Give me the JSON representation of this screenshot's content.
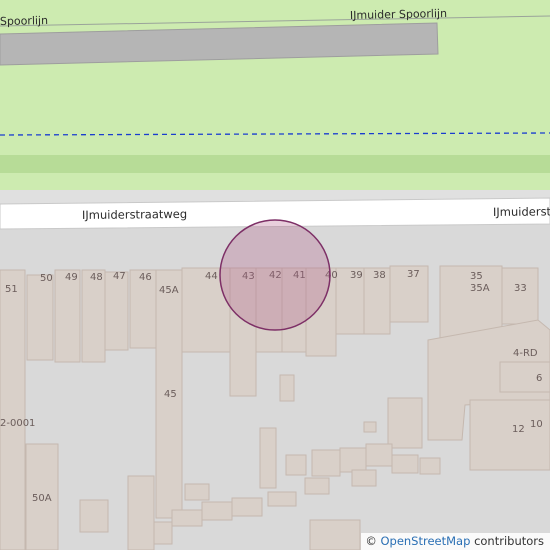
{
  "map": {
    "colors": {
      "background": "#d9d9d9",
      "park": "#cdebb0",
      "park_edge": "#b7dc97",
      "rail_platform": "#b5b5b5",
      "road": "#ffffff",
      "building": "#d9d0c9",
      "building_outline": "#c5b8af",
      "marker_fill": "#b45f8c",
      "marker_stroke": "#7d2f66",
      "boundary_dash": "#1a3dcf"
    },
    "railway": {
      "name_left": "Spoorlijn",
      "name_right": "IJmuider Spoorlijn"
    },
    "street": {
      "name_left": "IJmuiderstraatweg",
      "name_right": "IJmuiderst"
    },
    "house_numbers": [
      "51",
      "50",
      "49",
      "48",
      "47",
      "46",
      "45A",
      "44",
      "43",
      "42",
      "41",
      "40",
      "39",
      "38",
      "37",
      "35",
      "35A",
      "33",
      "4-RD",
      "6",
      "45",
      "12",
      "10",
      "2-0001",
      "50A"
    ],
    "marker": {
      "icon": "location-circle-icon"
    }
  },
  "attribution": {
    "symbol": "©",
    "link_text": "OpenStreetMap",
    "suffix": "contributors"
  }
}
